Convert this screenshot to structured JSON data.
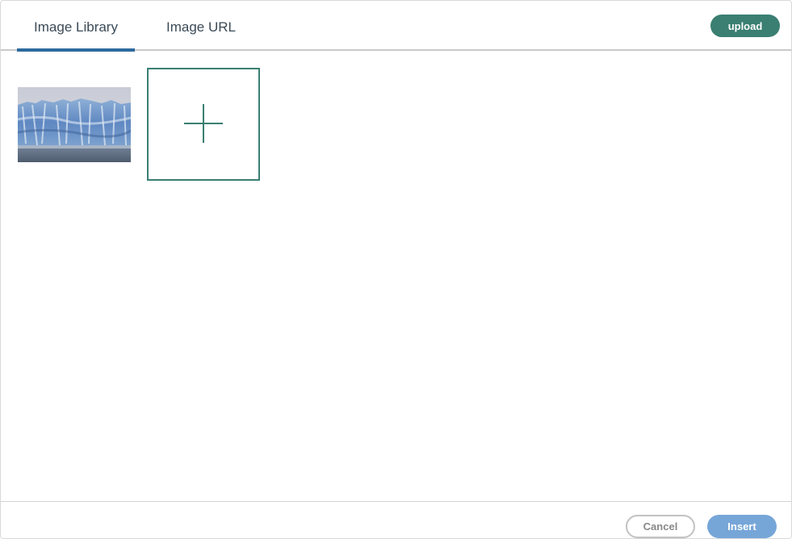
{
  "tabs": [
    {
      "label": "Image Library",
      "active": true
    },
    {
      "label": "Image URL",
      "active": false
    }
  ],
  "header": {
    "upload_label": "upload"
  },
  "library": {
    "images": [
      {
        "alt": "",
        "icon": "glacier-photo"
      }
    ],
    "add_icon": "plus-icon"
  },
  "footer": {
    "cancel_label": "Cancel",
    "insert_label": "Insert"
  },
  "colors": {
    "accent_teal": "#3a7f72",
    "tab_active_bar": "#2d6a9e",
    "insert_button": "#76a6d8",
    "cancel_border": "#c2c2c2"
  }
}
